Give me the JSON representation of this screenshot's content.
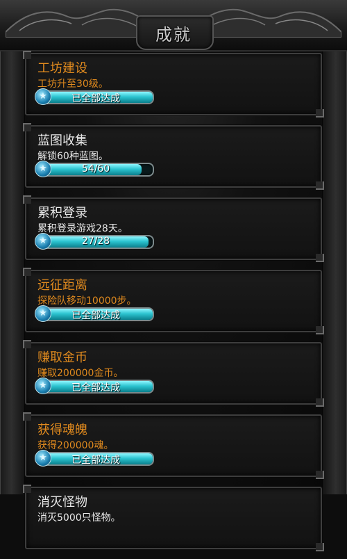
{
  "header": {
    "title": "成就"
  },
  "achievements": [
    {
      "title": "工坊建设",
      "description": "工坊升至30级。",
      "progress_text": "已全部达成",
      "progress": 1.0,
      "completed": true
    },
    {
      "title": "蓝图收集",
      "description": "解锁60种蓝图。",
      "progress_text": "54/60",
      "progress": 0.9,
      "completed": false
    },
    {
      "title": "累积登录",
      "description": "累积登录游戏28天。",
      "progress_text": "27/28",
      "progress": 0.964,
      "completed": false
    },
    {
      "title": "远征距离",
      "description": "探险队移动10000步。",
      "progress_text": "已全部达成",
      "progress": 1.0,
      "completed": true
    },
    {
      "title": "赚取金币",
      "description": "赚取200000金币。",
      "progress_text": "已全部达成",
      "progress": 1.0,
      "completed": true
    },
    {
      "title": "获得魂魄",
      "description": "获得200000魂。",
      "progress_text": "已全部达成",
      "progress": 1.0,
      "completed": true
    },
    {
      "title": "消灭怪物",
      "description": "消灭5000只怪物。",
      "progress_text": "",
      "progress": 0,
      "completed": false
    }
  ],
  "icons": {
    "badge": "star-icon"
  },
  "colors": {
    "completed_text": "#e08a1e",
    "pending_text": "#e8e8e8",
    "bar_fill": "#2cc4d0"
  }
}
